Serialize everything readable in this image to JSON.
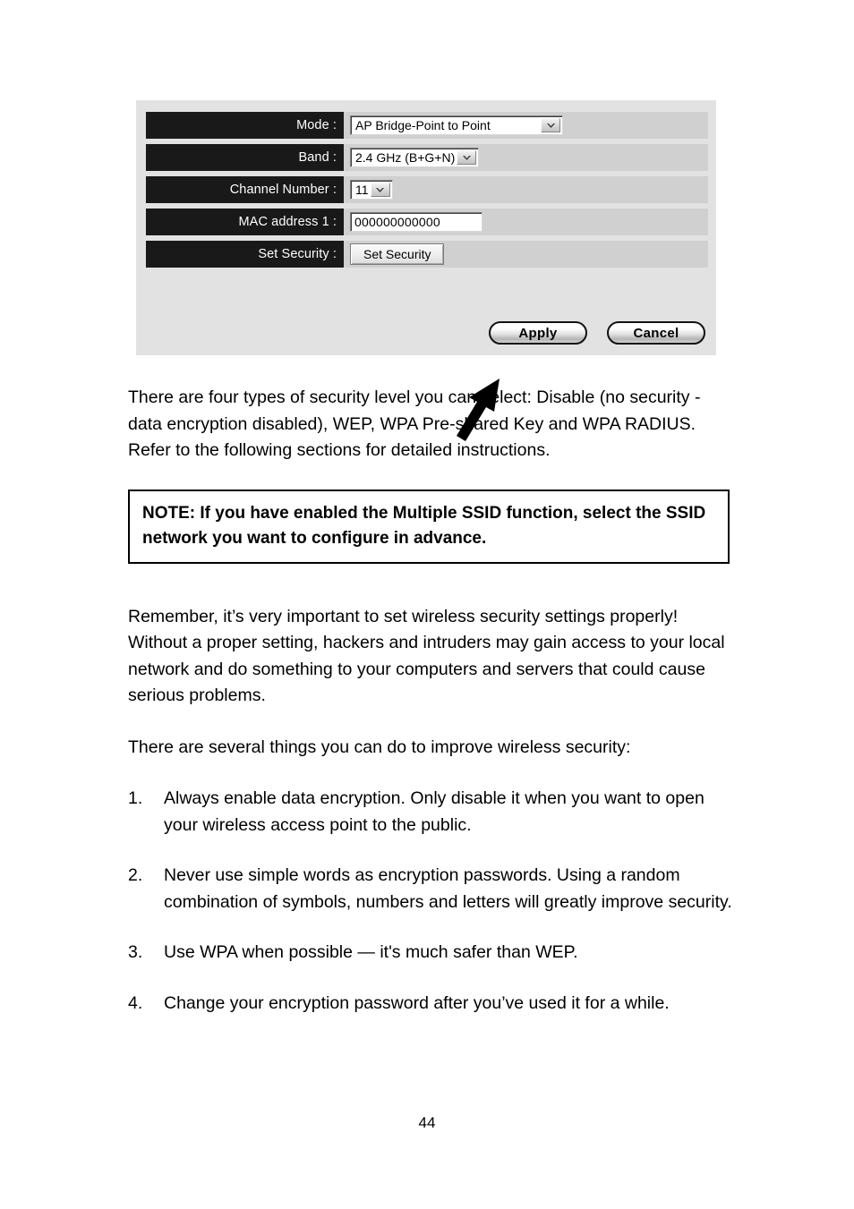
{
  "screenshot": {
    "rows": [
      {
        "label": "Mode :",
        "control": "select",
        "value": "AP Bridge-Point to Point",
        "name": "mode"
      },
      {
        "label": "Band :",
        "control": "select",
        "value": "2.4 GHz (B+G+N)",
        "name": "band"
      },
      {
        "label": "Channel Number :",
        "control": "select",
        "value": "11",
        "name": "channel-number"
      },
      {
        "label": "MAC address 1 :",
        "control": "text",
        "value": "000000000000",
        "name": "mac-address-1"
      },
      {
        "label": "Set Security :",
        "control": "button",
        "value": "Set Security",
        "name": "set-security"
      }
    ],
    "apply_label": "Apply",
    "cancel_label": "Cancel",
    "panel_bg": "#e2e2e2",
    "row_bg": "#d0d0d0",
    "label_bg": "#191919",
    "label_fg": "#ffffff"
  },
  "document": {
    "intro_paragraph": "There are four types of security level you can select: Disable (no security - data encryption disabled), WEP, WPA Pre-shared Key and WPA RADIUS. Refer to the following sections for detailed instructions.",
    "note": "NOTE: If you have enabled the Multiple SSID function, select the SSID network you want to configure in advance.",
    "remember_paragraph": "Remember, it’s very important to set wireless security settings properly! Without a proper setting, hackers and intruders may gain access to your local network and do something to your computers and servers that could cause serious problems.",
    "list_intro": "There are several things you can do to improve wireless security:",
    "tips": [
      {
        "num": "1.",
        "text": "Always enable data encryption. Only disable it when you want to open your wireless access point to the public."
      },
      {
        "num": "2.",
        "text": "Never use simple words as encryption passwords. Using a random combination of symbols, numbers and letters will greatly improve security."
      },
      {
        "num": "3.",
        "text": "Use WPA when possible — it's much safer than WEP."
      },
      {
        "num": "4.",
        "text": "Change your encryption password after you’ve used it for a while."
      }
    ],
    "page_number": "44"
  }
}
